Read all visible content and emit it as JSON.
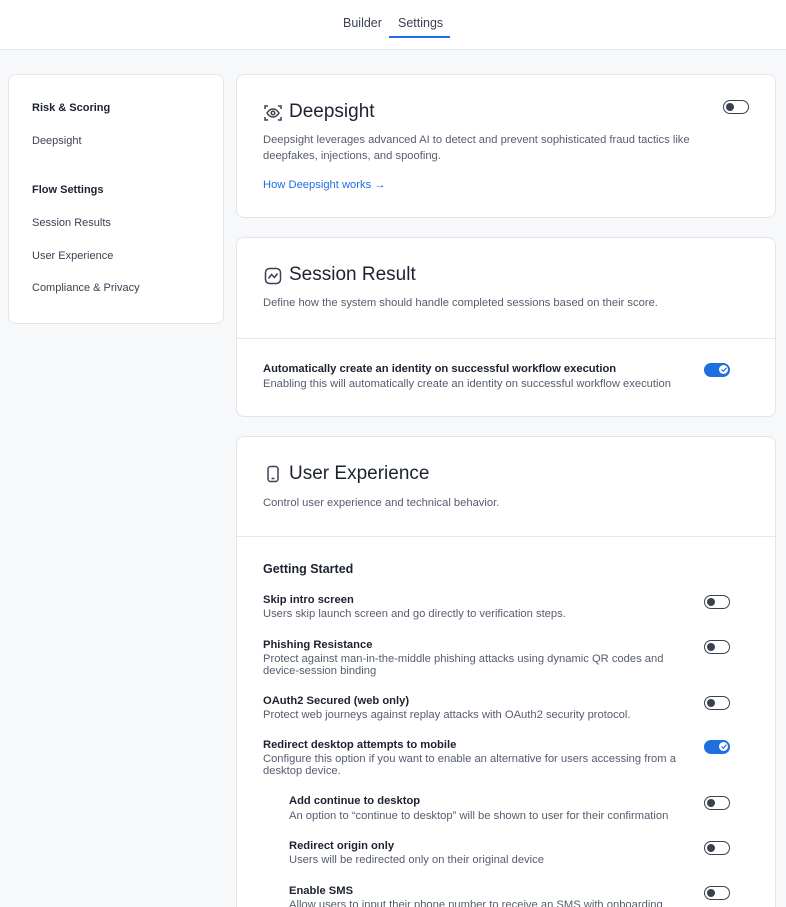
{
  "tabs": {
    "builder": "Builder",
    "settings": "Settings"
  },
  "sidebar": {
    "risk_heading": "Risk & Scoring",
    "deepsight": "Deepsight",
    "flow_heading": "Flow Settings",
    "session_results": "Session Results",
    "user_experience": "User Experience",
    "compliance": "Compliance & Privacy"
  },
  "deepsight": {
    "title": "Deepsight",
    "icon": "eye-scan-icon",
    "desc": "Deepsight leverages advanced AI to detect and prevent sophisticated fraud tactics like deepfakes, injections, and spoofing.",
    "link": "How Deepsight works →",
    "enabled": false
  },
  "session": {
    "title": "Session Result",
    "icon": "chart-line-icon",
    "desc": "Define how the system should handle completed sessions based on their score.",
    "auto_identity": {
      "title": "Automatically create an identity on successful workflow execution",
      "desc": "Enabling this will automatically create an identity on successful workflow execution",
      "enabled": true
    }
  },
  "ux": {
    "title": "User Experience",
    "icon": "phone-icon",
    "desc": "Control user experience and technical behavior.",
    "section": "Getting Started",
    "skip_intro": {
      "title": "Skip intro screen",
      "desc": "Users skip launch screen and go directly to verification steps.",
      "enabled": false
    },
    "phishing": {
      "title": "Phishing Resistance",
      "desc1": "Protect against man-in-the-middle phishing attacks using dynamic QR codes and",
      "desc2": "device-session binding",
      "enabled": false
    },
    "oauth": {
      "title": "OAuth2 Secured (web only)",
      "desc": "Protect web journeys against replay attacks with OAuth2 security protocol.",
      "enabled": false
    },
    "redirect": {
      "title": "Redirect desktop attempts to mobile",
      "desc1": "Configure this option if you want to enable an alternative for users accessing from a",
      "desc2": "desktop device.",
      "enabled": true
    },
    "continue_desktop": {
      "title": "Add continue to desktop",
      "desc": "An option to “continue to desktop” will be shown to user for their confirmation",
      "enabled": false
    },
    "redirect_origin": {
      "title": "Redirect origin only",
      "desc": "Users will be redirected only on their original device",
      "enabled": false
    },
    "sms": {
      "title": "Enable SMS",
      "desc": "Allow users to input their phone number to receive an SMS with onboarding",
      "enabled": false
    }
  },
  "colors": {
    "accent": "#1f6fe0",
    "toggle_off": "#3a4150"
  }
}
